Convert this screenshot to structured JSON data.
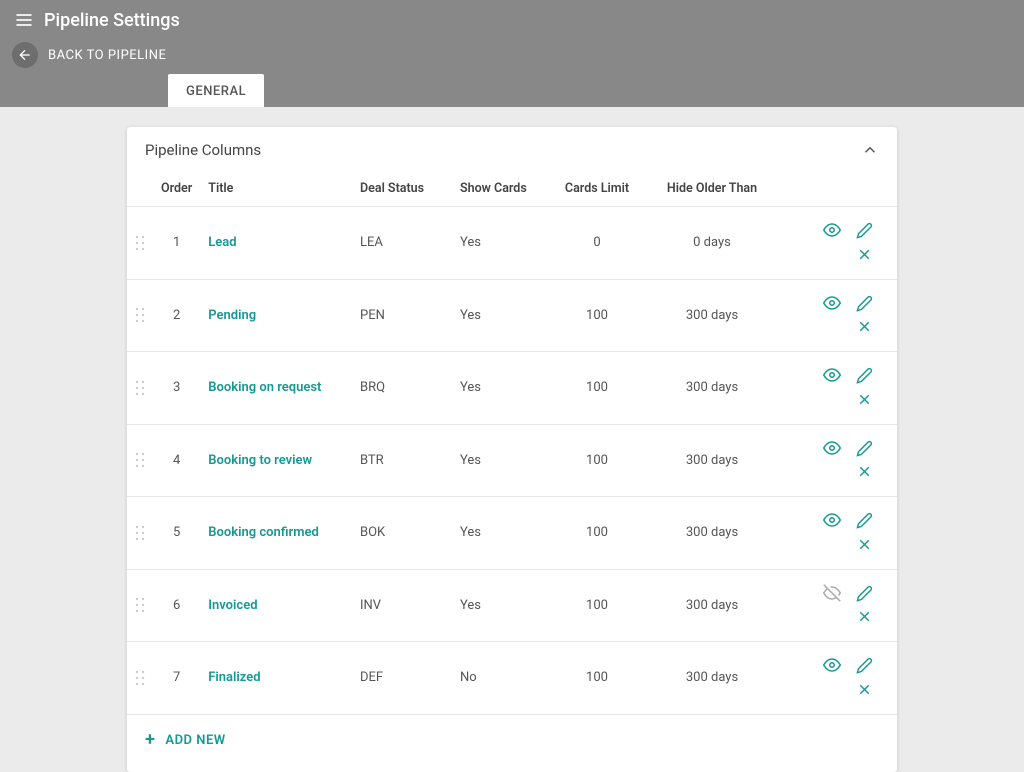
{
  "header": {
    "title": "Pipeline Settings",
    "back_label": "BACK TO PIPELINE"
  },
  "tabs": [
    {
      "label": "GENERAL",
      "active": true
    }
  ],
  "card": {
    "title": "Pipeline Columns",
    "add_label": "ADD NEW",
    "columns": {
      "order": "Order",
      "title": "Title",
      "deal_status": "Deal Status",
      "show_cards": "Show Cards",
      "cards_limit": "Cards Limit",
      "hide_older": "Hide Older Than"
    },
    "rows": [
      {
        "order": "1",
        "title": "Lead",
        "deal_status": "LEA",
        "show_cards": "Yes",
        "cards_limit": "0",
        "hide_older": "0 days",
        "visible": true
      },
      {
        "order": "2",
        "title": "Pending",
        "deal_status": "PEN",
        "show_cards": "Yes",
        "cards_limit": "100",
        "hide_older": "300 days",
        "visible": true
      },
      {
        "order": "3",
        "title": "Booking on request",
        "deal_status": "BRQ",
        "show_cards": "Yes",
        "cards_limit": "100",
        "hide_older": "300 days",
        "visible": true
      },
      {
        "order": "4",
        "title": "Booking to review",
        "deal_status": "BTR",
        "show_cards": "Yes",
        "cards_limit": "100",
        "hide_older": "300 days",
        "visible": true
      },
      {
        "order": "5",
        "title": "Booking confirmed",
        "deal_status": "BOK",
        "show_cards": "Yes",
        "cards_limit": "100",
        "hide_older": "300 days",
        "visible": true
      },
      {
        "order": "6",
        "title": "Invoiced",
        "deal_status": "INV",
        "show_cards": "Yes",
        "cards_limit": "100",
        "hide_older": "300 days",
        "visible": false
      },
      {
        "order": "7",
        "title": "Finalized",
        "deal_status": "DEF",
        "show_cards": "No",
        "cards_limit": "100",
        "hide_older": "300 days",
        "visible": true
      }
    ]
  }
}
